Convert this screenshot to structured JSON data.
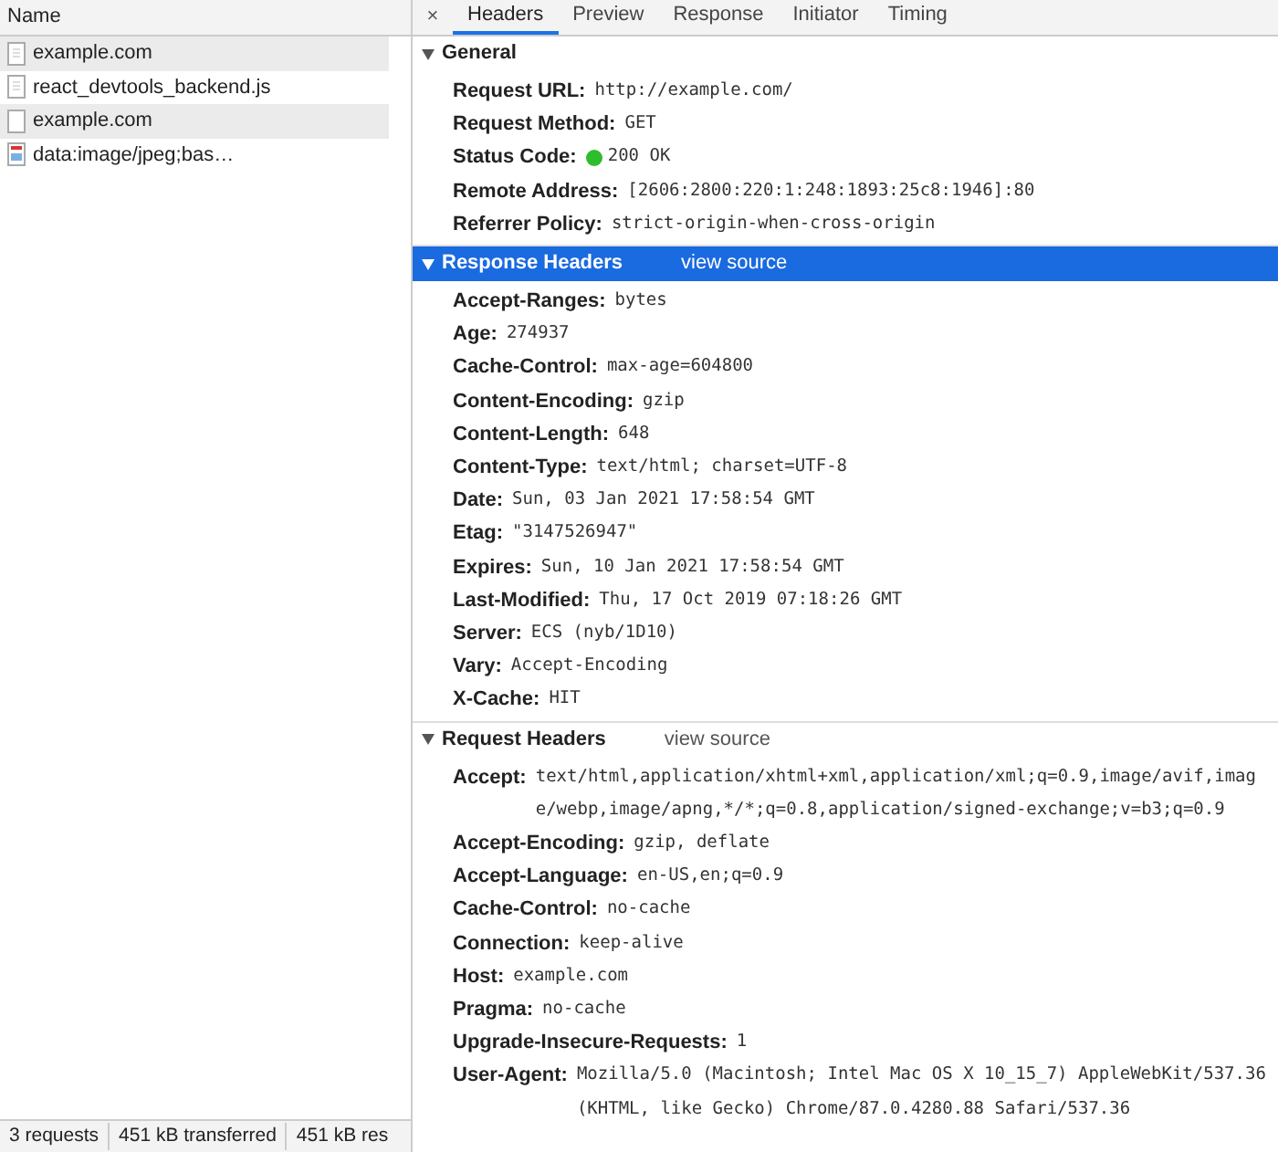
{
  "request_list": {
    "column": "Name",
    "rows": [
      {
        "name": "example.com",
        "kind": "document"
      },
      {
        "name": "react_devtools_backend.js",
        "kind": "script"
      },
      {
        "name": "example.com",
        "kind": "blank"
      },
      {
        "name": "data:image/jpeg;bas…",
        "kind": "image"
      }
    ]
  },
  "status_bar": [
    "3 requests",
    "451 kB transferred",
    "451 kB res"
  ],
  "close": "×",
  "tabs": [
    {
      "label": "Headers",
      "selected": true
    },
    {
      "label": "Preview",
      "selected": false
    },
    {
      "label": "Response",
      "selected": false
    },
    {
      "label": "Initiator",
      "selected": false
    },
    {
      "label": "Timing",
      "selected": false
    }
  ],
  "sections": [
    {
      "title": "General",
      "expanded": true,
      "selected": false,
      "items": [
        {
          "name": "Request URL:",
          "value": "http://example.com/"
        },
        {
          "name": "Request Method:",
          "value": "GET"
        },
        {
          "name": "Status Code:",
          "value": "200 OK",
          "color": "#2dbd2d"
        },
        {
          "name": "Remote Address:",
          "value": "[2606:2800:220:1:248:1893:25c8:1946]:80"
        },
        {
          "name": "Referrer Policy:",
          "value": "strict-origin-when-cross-origin"
        }
      ]
    },
    {
      "title": "Response Headers",
      "link": "view source",
      "expanded": true,
      "selected": true,
      "items": [
        {
          "name": "Accept-Ranges:",
          "value": "bytes"
        },
        {
          "name": "Age:",
          "value": "274937"
        },
        {
          "name": "Cache-Control:",
          "value": "max-age=604800"
        },
        {
          "name": "Content-Encoding:",
          "value": "gzip"
        },
        {
          "name": "Content-Length:",
          "value": "648"
        },
        {
          "name": "Content-Type:",
          "value": "text/html; charset=UTF-8"
        },
        {
          "name": "Date:",
          "value": "Sun, 03 Jan 2021 17:58:54 GMT"
        },
        {
          "name": "Etag:",
          "value": "\"3147526947\""
        },
        {
          "name": "Expires:",
          "value": "Sun, 10 Jan 2021 17:58:54 GMT"
        },
        {
          "name": "Last-Modified:",
          "value": "Thu, 17 Oct 2019 07:18:26 GMT"
        },
        {
          "name": "Server:",
          "value": "ECS (nyb/1D10)"
        },
        {
          "name": "Vary:",
          "value": "Accept-Encoding"
        },
        {
          "name": "X-Cache:",
          "value": "HIT"
        }
      ]
    },
    {
      "title": "Request Headers",
      "link": "view source",
      "expanded": true,
      "selected": false,
      "items": [
        {
          "name": "Accept:",
          "value": "text/html,application/xhtml+xml,application/xml;q=0.9,image/avif,image/webp,image/apng,*/*;q=0.8,application/signed-exchange;v=b3;q=0.9"
        },
        {
          "name": "Accept-Encoding:",
          "value": "gzip, deflate"
        },
        {
          "name": "Accept-Language:",
          "value": "en-US,en;q=0.9"
        },
        {
          "name": "Cache-Control:",
          "value": "no-cache"
        },
        {
          "name": "Connection:",
          "value": "keep-alive"
        },
        {
          "name": "Host:",
          "value": "example.com"
        },
        {
          "name": "Pragma:",
          "value": "no-cache"
        },
        {
          "name": "Upgrade-Insecure-Requests:",
          "value": "1"
        },
        {
          "name": "User-Agent:",
          "value": "Mozilla/5.0 (Macintosh; Intel Mac OS X 10_15_7) AppleWebKit/537.36 (KHTML, like Gecko) Chrome/87.0.4280.88 Safari/537.36"
        }
      ]
    }
  ]
}
